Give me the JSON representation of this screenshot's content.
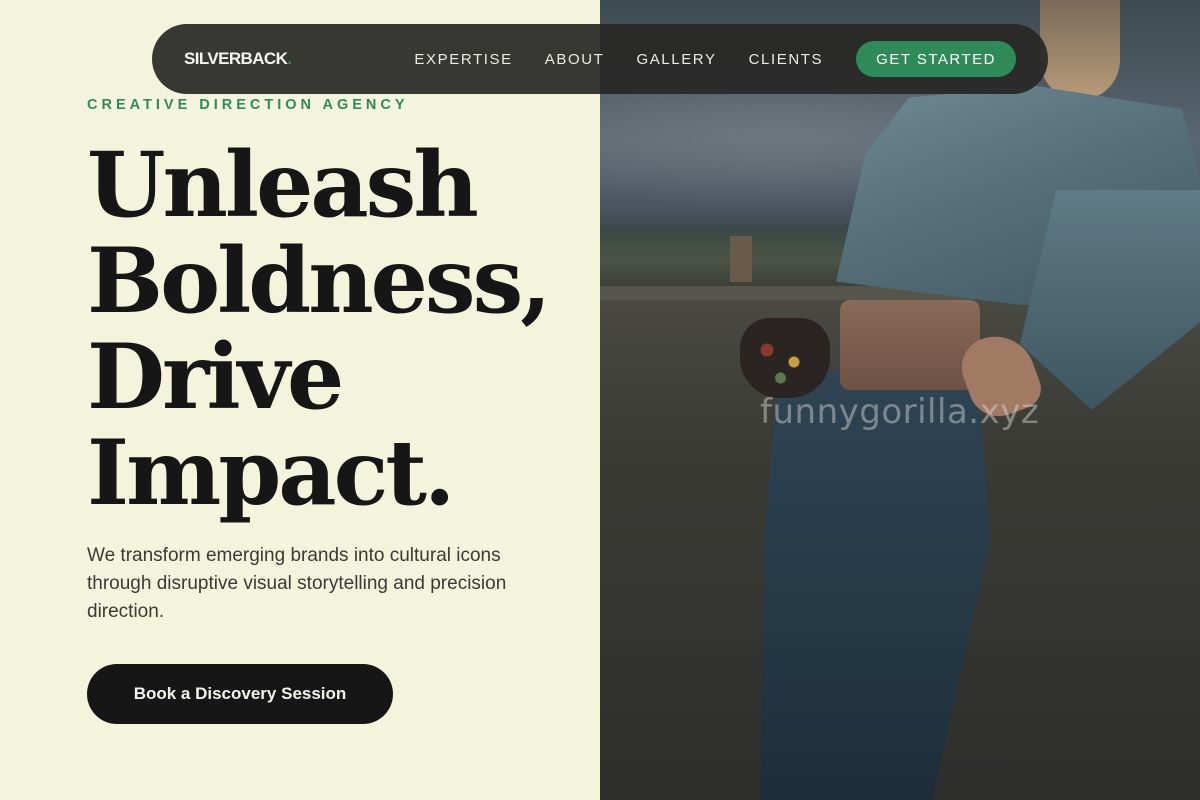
{
  "nav": {
    "logo": "SILVERBACK",
    "logo_dot": ".",
    "links": [
      "EXPERTISE",
      "ABOUT",
      "GALLERY",
      "CLIENTS"
    ],
    "cta": "GET STARTED"
  },
  "hero": {
    "eyebrow": "CREATIVE DIRECTION AGENCY",
    "headline_lines": [
      "Unleash",
      "Boldness,",
      "Drive",
      "Impact."
    ],
    "subtext": "We transform emerging brands into cultural icons through disruptive visual storytelling and precision direction.",
    "cta": "Book a Discovery Session"
  },
  "watermark": "funnygorilla.xyz",
  "colors": {
    "accent": "#2e8b57",
    "background": "#f4f4dc",
    "text_dark": "#161616",
    "nav_bg": "#282826"
  }
}
